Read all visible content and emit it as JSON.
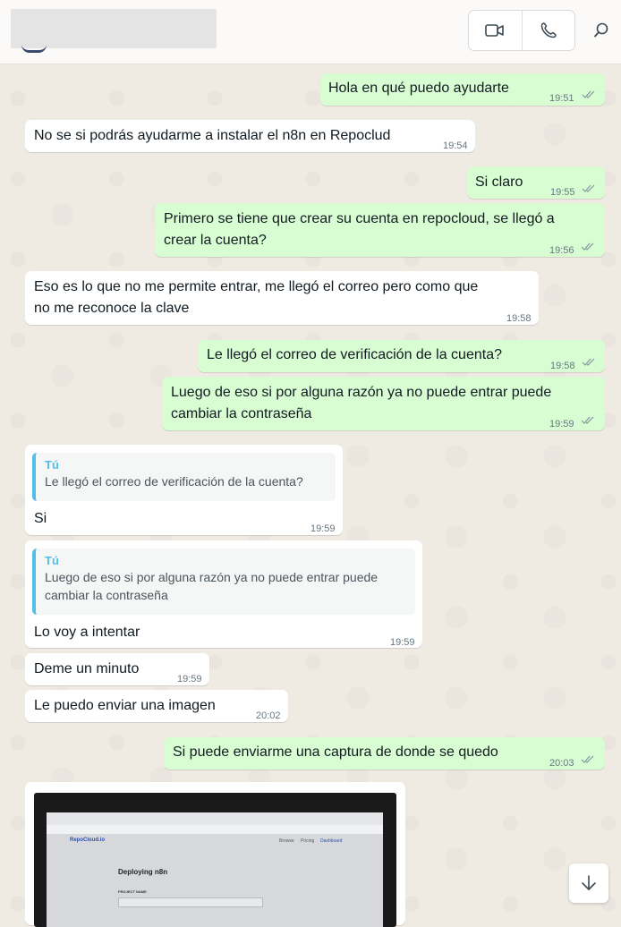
{
  "header": {
    "video_icon": "video-camera-icon",
    "call_icon": "phone-icon",
    "search_icon": "search-icon"
  },
  "messages": [
    {
      "text": "Hola en qué puedo ayudarte",
      "time": "19:51"
    },
    {
      "text": "No se si podrás ayudarme a instalar el n8n en Repoclud",
      "time": "19:54"
    },
    {
      "text": "Si claro",
      "time": "19:55"
    },
    {
      "line1": "Primero se tiene que crear su cuenta en repocloud, se llegó a",
      "line2": "crear la cuenta?",
      "time": "19:56"
    },
    {
      "line1": "Eso es lo que no me permite entrar, me llegó el correo pero como que",
      "line2": "no me reconoce la clave",
      "time": "19:58"
    },
    {
      "text": "Le llegó el correo de verificación de la cuenta?",
      "time": "19:58"
    },
    {
      "line1": "Luego de eso si por alguna razón ya no puede entrar puede",
      "line2": "cambiar la contraseña",
      "time": "19:59"
    },
    {
      "quote_author": "Tú",
      "quote_text": "Le llegó el correo de verificación de la cuenta?",
      "text": "Si",
      "time": "19:59"
    },
    {
      "quote_author": "Tú",
      "quote_line1": "Luego de eso si por alguna razón ya no puede entrar puede",
      "quote_line2": "cambiar la contraseña",
      "text": "Lo voy a intentar",
      "time": "19:59"
    },
    {
      "text": "Deme un minuto",
      "time": "19:59"
    },
    {
      "text": "Le puedo enviar una imagen",
      "time": "20:02"
    },
    {
      "text": "Si puede enviarme una captura de donde se quedo",
      "time": "20:03"
    }
  ],
  "image_message": {
    "screen_logo": "RepoCloud.io",
    "screen_title": "Deploying n8n",
    "screen_field_label": "PROJECT NAME",
    "screen_nav": [
      "Browse",
      "Pricing",
      "Dashboard"
    ]
  },
  "colors": {
    "outgoing_bubble": "#d9fdd3",
    "incoming_bubble": "#ffffff",
    "chat_background": "#efeae2",
    "quote_accent": "#53bdeb"
  }
}
